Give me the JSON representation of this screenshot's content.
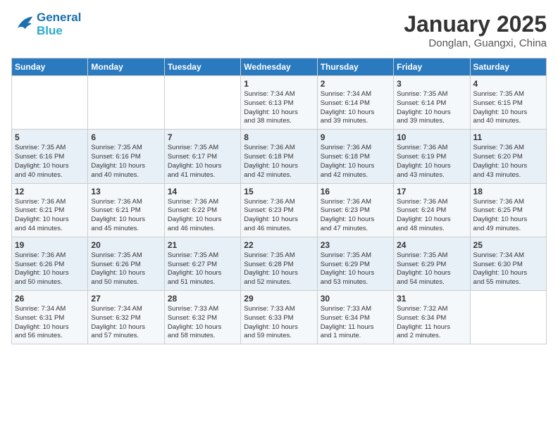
{
  "header": {
    "logo_line1": "General",
    "logo_line2": "Blue",
    "month_title": "January 2025",
    "location": "Donglan, Guangxi, China"
  },
  "weekdays": [
    "Sunday",
    "Monday",
    "Tuesday",
    "Wednesday",
    "Thursday",
    "Friday",
    "Saturday"
  ],
  "weeks": [
    [
      {
        "day": "",
        "info": ""
      },
      {
        "day": "",
        "info": ""
      },
      {
        "day": "",
        "info": ""
      },
      {
        "day": "1",
        "info": "Sunrise: 7:34 AM\nSunset: 6:13 PM\nDaylight: 10 hours\nand 38 minutes."
      },
      {
        "day": "2",
        "info": "Sunrise: 7:34 AM\nSunset: 6:14 PM\nDaylight: 10 hours\nand 39 minutes."
      },
      {
        "day": "3",
        "info": "Sunrise: 7:35 AM\nSunset: 6:14 PM\nDaylight: 10 hours\nand 39 minutes."
      },
      {
        "day": "4",
        "info": "Sunrise: 7:35 AM\nSunset: 6:15 PM\nDaylight: 10 hours\nand 40 minutes."
      }
    ],
    [
      {
        "day": "5",
        "info": "Sunrise: 7:35 AM\nSunset: 6:16 PM\nDaylight: 10 hours\nand 40 minutes."
      },
      {
        "day": "6",
        "info": "Sunrise: 7:35 AM\nSunset: 6:16 PM\nDaylight: 10 hours\nand 40 minutes."
      },
      {
        "day": "7",
        "info": "Sunrise: 7:35 AM\nSunset: 6:17 PM\nDaylight: 10 hours\nand 41 minutes."
      },
      {
        "day": "8",
        "info": "Sunrise: 7:36 AM\nSunset: 6:18 PM\nDaylight: 10 hours\nand 42 minutes."
      },
      {
        "day": "9",
        "info": "Sunrise: 7:36 AM\nSunset: 6:18 PM\nDaylight: 10 hours\nand 42 minutes."
      },
      {
        "day": "10",
        "info": "Sunrise: 7:36 AM\nSunset: 6:19 PM\nDaylight: 10 hours\nand 43 minutes."
      },
      {
        "day": "11",
        "info": "Sunrise: 7:36 AM\nSunset: 6:20 PM\nDaylight: 10 hours\nand 43 minutes."
      }
    ],
    [
      {
        "day": "12",
        "info": "Sunrise: 7:36 AM\nSunset: 6:21 PM\nDaylight: 10 hours\nand 44 minutes."
      },
      {
        "day": "13",
        "info": "Sunrise: 7:36 AM\nSunset: 6:21 PM\nDaylight: 10 hours\nand 45 minutes."
      },
      {
        "day": "14",
        "info": "Sunrise: 7:36 AM\nSunset: 6:22 PM\nDaylight: 10 hours\nand 46 minutes."
      },
      {
        "day": "15",
        "info": "Sunrise: 7:36 AM\nSunset: 6:23 PM\nDaylight: 10 hours\nand 46 minutes."
      },
      {
        "day": "16",
        "info": "Sunrise: 7:36 AM\nSunset: 6:23 PM\nDaylight: 10 hours\nand 47 minutes."
      },
      {
        "day": "17",
        "info": "Sunrise: 7:36 AM\nSunset: 6:24 PM\nDaylight: 10 hours\nand 48 minutes."
      },
      {
        "day": "18",
        "info": "Sunrise: 7:36 AM\nSunset: 6:25 PM\nDaylight: 10 hours\nand 49 minutes."
      }
    ],
    [
      {
        "day": "19",
        "info": "Sunrise: 7:36 AM\nSunset: 6:26 PM\nDaylight: 10 hours\nand 50 minutes."
      },
      {
        "day": "20",
        "info": "Sunrise: 7:35 AM\nSunset: 6:26 PM\nDaylight: 10 hours\nand 50 minutes."
      },
      {
        "day": "21",
        "info": "Sunrise: 7:35 AM\nSunset: 6:27 PM\nDaylight: 10 hours\nand 51 minutes."
      },
      {
        "day": "22",
        "info": "Sunrise: 7:35 AM\nSunset: 6:28 PM\nDaylight: 10 hours\nand 52 minutes."
      },
      {
        "day": "23",
        "info": "Sunrise: 7:35 AM\nSunset: 6:29 PM\nDaylight: 10 hours\nand 53 minutes."
      },
      {
        "day": "24",
        "info": "Sunrise: 7:35 AM\nSunset: 6:29 PM\nDaylight: 10 hours\nand 54 minutes."
      },
      {
        "day": "25",
        "info": "Sunrise: 7:34 AM\nSunset: 6:30 PM\nDaylight: 10 hours\nand 55 minutes."
      }
    ],
    [
      {
        "day": "26",
        "info": "Sunrise: 7:34 AM\nSunset: 6:31 PM\nDaylight: 10 hours\nand 56 minutes."
      },
      {
        "day": "27",
        "info": "Sunrise: 7:34 AM\nSunset: 6:32 PM\nDaylight: 10 hours\nand 57 minutes."
      },
      {
        "day": "28",
        "info": "Sunrise: 7:33 AM\nSunset: 6:32 PM\nDaylight: 10 hours\nand 58 minutes."
      },
      {
        "day": "29",
        "info": "Sunrise: 7:33 AM\nSunset: 6:33 PM\nDaylight: 10 hours\nand 59 minutes."
      },
      {
        "day": "30",
        "info": "Sunrise: 7:33 AM\nSunset: 6:34 PM\nDaylight: 11 hours\nand 1 minute."
      },
      {
        "day": "31",
        "info": "Sunrise: 7:32 AM\nSunset: 6:34 PM\nDaylight: 11 hours\nand 2 minutes."
      },
      {
        "day": "",
        "info": ""
      }
    ]
  ]
}
